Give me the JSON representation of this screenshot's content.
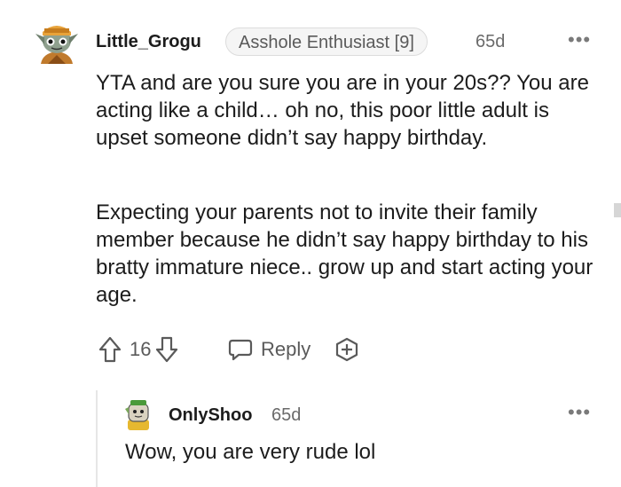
{
  "comment": {
    "avatar": "grogu-avatar",
    "username": "Little_Grogu",
    "flair": "Asshole Enthusiast [9]",
    "age": "65d",
    "more_label": "•••",
    "paragraphs": [
      "YTA and are you sure you are in your 20s?? You are acting like a child… oh no, this poor little adult is upset someone didn’t say happy birthday.",
      "Expecting your parents not to invite their family member because he didn’t say happy birthday to his bratty immature niece.. grow up and start acting your age."
    ],
    "score": "16",
    "reply_label": "Reply",
    "icons": {
      "upvote": "upvote-icon",
      "downvote": "downvote-icon",
      "reply": "speech-bubble-icon",
      "award": "award-plus-icon"
    }
  },
  "reply": {
    "avatar": "onlyshoo-avatar",
    "username": "OnlyShoo",
    "age": "65d",
    "more_label": "•••",
    "text": "Wow, you are very rude lol"
  },
  "colors": {
    "text": "#1c1c1c",
    "meta": "#6a6a6a",
    "flair_bg": "#f5f5f5"
  }
}
